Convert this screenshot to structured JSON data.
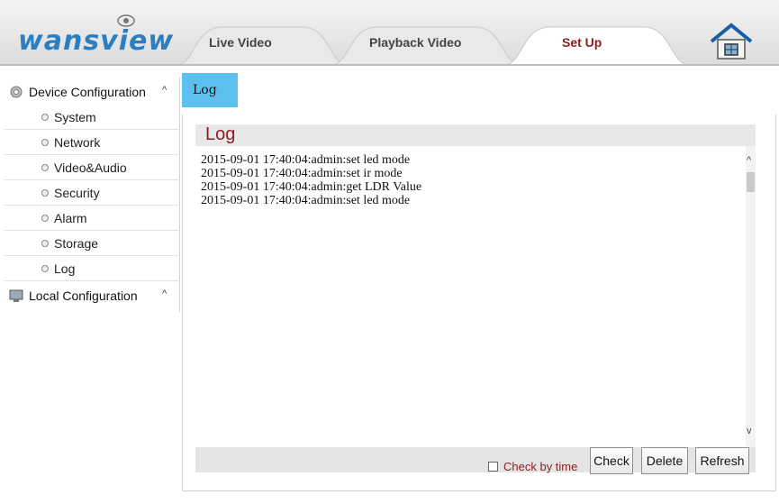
{
  "brand": {
    "logo_text": "wansview"
  },
  "tabs": [
    {
      "label": "Live Video"
    },
    {
      "label": "Playback Video"
    },
    {
      "label": "Set Up",
      "active": true
    }
  ],
  "colors": {
    "accent_tab": "#5bc0f0",
    "title_red": "#8b1d1d",
    "brand_blue": "#2b7fc0"
  },
  "sidebar": {
    "device_group": {
      "label": "Device Configuration",
      "caret": "^",
      "icon": "gear-icon"
    },
    "items": [
      {
        "label": "System"
      },
      {
        "label": "Network"
      },
      {
        "label": "Video&Audio"
      },
      {
        "label": "Security"
      },
      {
        "label": "Alarm"
      },
      {
        "label": "Storage"
      },
      {
        "label": "Log"
      }
    ],
    "local_group": {
      "label": "Local Configuration",
      "caret": "^",
      "icon": "computer-icon"
    }
  },
  "content": {
    "tab_label": "Log",
    "panel_title": "Log",
    "log_lines": [
      "2015-09-01 17:40:04:admin:set led mode",
      "2015-09-01 17:40:04:admin:set ir mode",
      "2015-09-01 17:40:04:admin:get LDR Value",
      "2015-09-01 17:40:04:admin:set led mode"
    ],
    "scroll_up": "^",
    "scroll_down": "v",
    "check_by_time_label": "Check by time",
    "buttons": {
      "check": "Check",
      "delete": "Delete",
      "refresh": "Refresh"
    }
  }
}
